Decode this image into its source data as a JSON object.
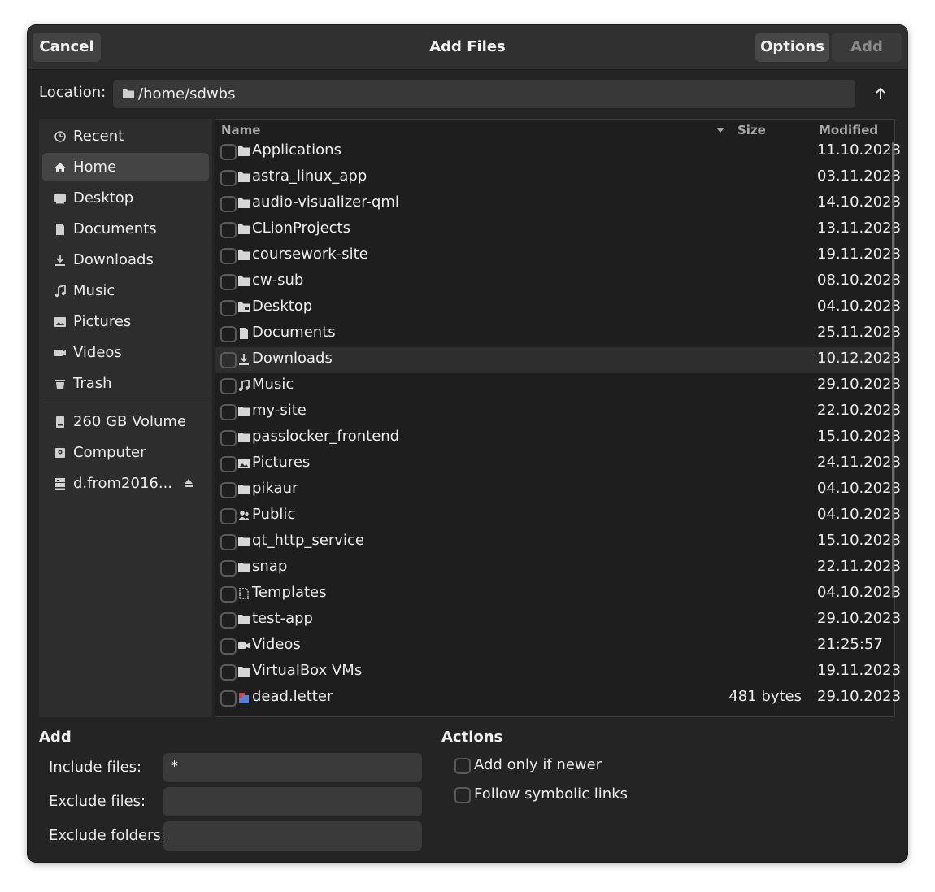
{
  "header": {
    "cancel_label": "Cancel",
    "title": "Add Files",
    "options_label": "Options",
    "add_label": "Add"
  },
  "location": {
    "label": "Location:",
    "path": "/home/sdwbs"
  },
  "sidebar": {
    "items": [
      {
        "label": "Recent",
        "icon": "clock-icon"
      },
      {
        "label": "Home",
        "icon": "home-icon"
      },
      {
        "label": "Desktop",
        "icon": "desktop-icon"
      },
      {
        "label": "Documents",
        "icon": "document-icon"
      },
      {
        "label": "Downloads",
        "icon": "download-icon"
      },
      {
        "label": "Music",
        "icon": "music-icon"
      },
      {
        "label": "Pictures",
        "icon": "picture-icon"
      },
      {
        "label": "Videos",
        "icon": "video-icon"
      },
      {
        "label": "Trash",
        "icon": "trash-icon"
      }
    ],
    "devices": [
      {
        "label": "260 GB Volume",
        "icon": "drive-icon"
      },
      {
        "label": "Computer",
        "icon": "computer-icon"
      },
      {
        "label": "d.from2016...",
        "icon": "network-drive-icon"
      }
    ],
    "active": "Home"
  },
  "filelist": {
    "columns": {
      "name": "Name",
      "size": "Size",
      "modified": "Modified"
    },
    "rows": [
      {
        "name": "Applications",
        "size": "",
        "modified": "11.10.2023",
        "icon": "folder-icon"
      },
      {
        "name": "astra_linux_app",
        "size": "",
        "modified": "03.11.2023",
        "icon": "folder-icon"
      },
      {
        "name": "audio-visualizer-qml",
        "size": "",
        "modified": "14.10.2023",
        "icon": "folder-icon"
      },
      {
        "name": "CLionProjects",
        "size": "",
        "modified": "13.11.2023",
        "icon": "folder-icon"
      },
      {
        "name": "coursework-site",
        "size": "",
        "modified": "19.11.2023",
        "icon": "folder-icon"
      },
      {
        "name": "cw-sub",
        "size": "",
        "modified": "08.10.2023",
        "icon": "folder-icon"
      },
      {
        "name": "Desktop",
        "size": "",
        "modified": "04.10.2023",
        "icon": "desktop-folder-icon"
      },
      {
        "name": "Documents",
        "size": "",
        "modified": "25.11.2023",
        "icon": "document-folder-icon"
      },
      {
        "name": "Downloads",
        "size": "",
        "modified": "10.12.2023",
        "icon": "download-icon"
      },
      {
        "name": "Music",
        "size": "",
        "modified": "29.10.2023",
        "icon": "music-icon"
      },
      {
        "name": "my-site",
        "size": "",
        "modified": "22.10.2023",
        "icon": "folder-icon"
      },
      {
        "name": "passlocker_frontend",
        "size": "",
        "modified": "15.10.2023",
        "icon": "folder-icon"
      },
      {
        "name": "Pictures",
        "size": "",
        "modified": "24.11.2023",
        "icon": "picture-icon"
      },
      {
        "name": "pikaur",
        "size": "",
        "modified": "04.10.2023",
        "icon": "folder-icon"
      },
      {
        "name": "Public",
        "size": "",
        "modified": "04.10.2023",
        "icon": "public-icon"
      },
      {
        "name": "qt_http_service",
        "size": "",
        "modified": "15.10.2023",
        "icon": "folder-icon"
      },
      {
        "name": "snap",
        "size": "",
        "modified": "22.11.2023",
        "icon": "folder-icon"
      },
      {
        "name": "Templates",
        "size": "",
        "modified": "04.10.2023",
        "icon": "template-icon"
      },
      {
        "name": "test-app",
        "size": "",
        "modified": "29.10.2023",
        "icon": "folder-icon"
      },
      {
        "name": "Videos",
        "size": "",
        "modified": "21:25:57",
        "icon": "video-icon"
      },
      {
        "name": "VirtualBox VMs",
        "size": "",
        "modified": "19.11.2023",
        "icon": "folder-icon"
      },
      {
        "name": "dead.letter",
        "size": "481 bytes",
        "modified": "29.10.2023",
        "icon": "mail-file-icon"
      }
    ],
    "highlighted_row": "Downloads"
  },
  "add_section": {
    "title": "Add",
    "include_label": "Include files:",
    "include_value": "*",
    "exclude_files_label": "Exclude files:",
    "exclude_files_value": "",
    "exclude_folders_label": "Exclude folders:",
    "exclude_folders_value": ""
  },
  "actions_section": {
    "title": "Actions",
    "newer_label": "Add only if newer",
    "symlinks_label": "Follow symbolic links"
  }
}
